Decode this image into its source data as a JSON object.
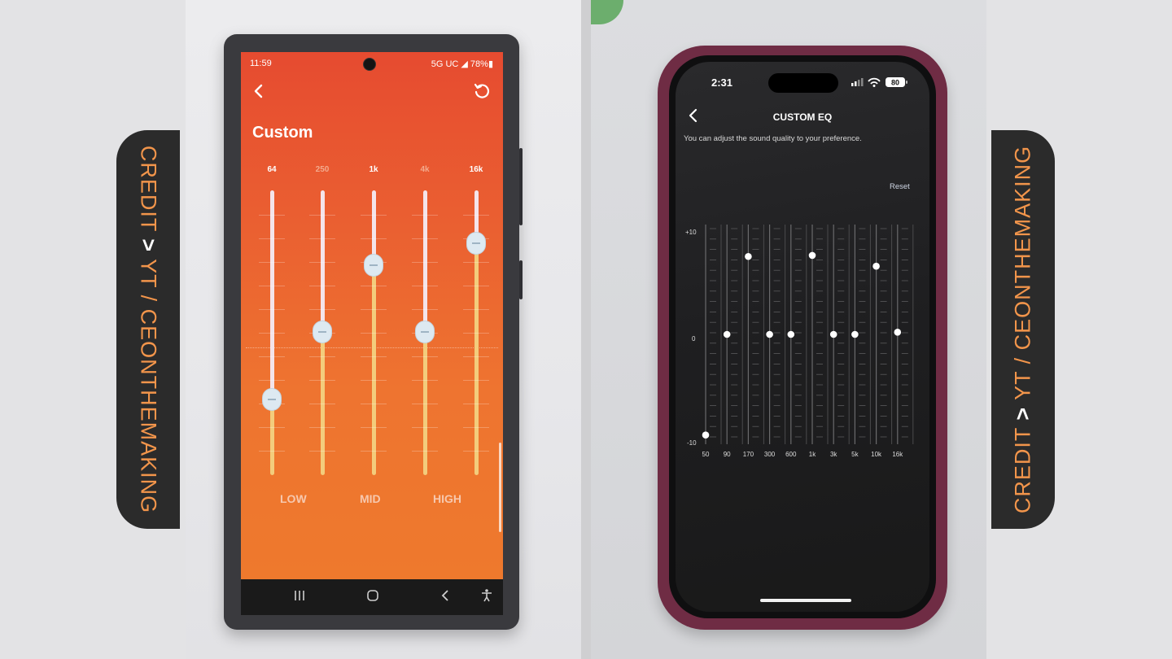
{
  "credit": {
    "left": {
      "part1": "CREDIT ",
      "arrow": ">",
      "part2": " YT / CEONTHEMAKING"
    },
    "right": {
      "part1": "CREDIT ",
      "arrow": ">",
      "part2": " YT / CEONTHEMAKING"
    },
    "text_color": "#f2954b"
  },
  "android": {
    "status": {
      "time": "11:59",
      "right": "5G UC ◢ 78%▮"
    },
    "title": "Custom",
    "bands": [
      {
        "freq": "64",
        "level": -0.5,
        "active": true
      },
      {
        "freq": "250",
        "level": 0.0,
        "active": false
      },
      {
        "freq": "1k",
        "level": 0.5,
        "active": true
      },
      {
        "freq": "4k",
        "level": 0.0,
        "active": false
      },
      {
        "freq": "16k",
        "level": 0.66,
        "active": true
      }
    ],
    "groups": [
      "LOW",
      "MID",
      "HIGH"
    ],
    "icons": [
      "back-arrow-icon",
      "reset-icon",
      "recents-icon",
      "home-icon",
      "nav-back-icon",
      "accessibility-icon"
    ],
    "colors": {
      "bg_top": "#e64b30",
      "bg_bottom": "#ee7a2c",
      "knob": "#dde9f1"
    }
  },
  "ios": {
    "time": "2:31",
    "battery": "80",
    "title": "CUSTOM EQ",
    "subtitle": "You can adjust the sound quality to your preference.",
    "reset_label": "Reset",
    "y_axis": {
      "max": "+10",
      "zero": "0",
      "min": "-10"
    },
    "bands": [
      {
        "freq": "50",
        "gain": -9.3
      },
      {
        "freq": "90",
        "gain": 0
      },
      {
        "freq": "170",
        "gain": 7.2
      },
      {
        "freq": "300",
        "gain": 0
      },
      {
        "freq": "600",
        "gain": 0
      },
      {
        "freq": "1k",
        "gain": 7.3
      },
      {
        "freq": "3k",
        "gain": 0
      },
      {
        "freq": "5k",
        "gain": 0
      },
      {
        "freq": "10k",
        "gain": 6.3
      },
      {
        "freq": "16k",
        "gain": 0.2
      }
    ],
    "icons": [
      "back-chevron-icon",
      "signal-icon",
      "wifi-icon",
      "battery-icon"
    ]
  }
}
